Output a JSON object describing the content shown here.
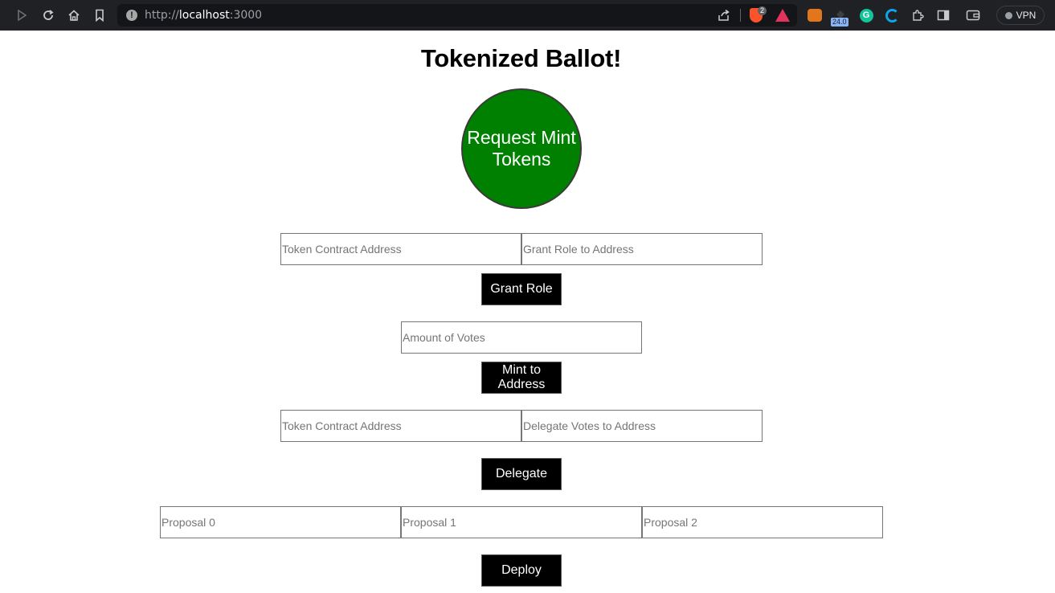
{
  "browser": {
    "url_scheme": "http://",
    "url_host": "localhost",
    "url_port": ":3000",
    "brave_shield_count": "2",
    "extension_badge": "24.0",
    "vpn_label": "VPN",
    "grammarly_letter": "G"
  },
  "page": {
    "title": "Tokenized Ballot!",
    "mint_button_label": "Request Mint Tokens",
    "grant_role": {
      "token_contract_placeholder": "Token Contract Address",
      "grant_address_placeholder": "Grant Role to Address",
      "button_label": "Grant Role"
    },
    "mint": {
      "votes_placeholder": "Amount of Votes",
      "button_label": "Mint to Address"
    },
    "delegate": {
      "token_contract_placeholder": "Token Contract Address",
      "delegate_address_placeholder": "Delegate Votes to Address",
      "button_label": "Delegate"
    },
    "deploy": {
      "proposal_0_placeholder": "Proposal 0",
      "proposal_1_placeholder": "Proposal 1",
      "proposal_2_placeholder": "Proposal 2",
      "button_label": "Deploy"
    }
  },
  "colors": {
    "mint_circle": "#008000",
    "button_bg": "#000000",
    "chrome_bg": "#202124"
  }
}
